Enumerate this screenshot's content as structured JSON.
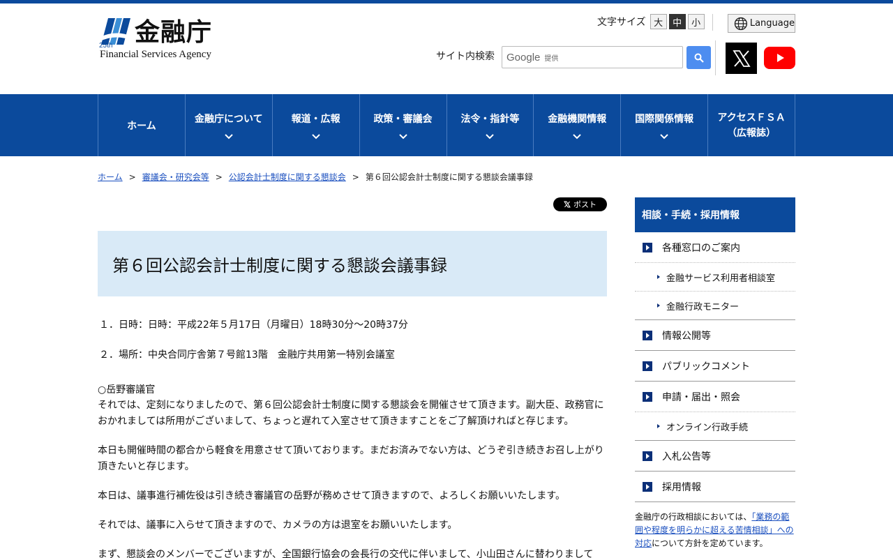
{
  "header": {
    "logo_text": "金融庁",
    "logo_en": "Financial Services Agency",
    "logo_badge": "25th",
    "font_size_label": "文字サイズ",
    "font_sizes": [
      "大",
      "中",
      "小"
    ],
    "font_size_active": "中",
    "language_label": "Language",
    "search_label": "サイト内検索",
    "search_google": "Google",
    "search_provided": "提供"
  },
  "nav": {
    "items": [
      {
        "label": "ホーム",
        "has_menu": false
      },
      {
        "label": "金融庁について",
        "has_menu": true
      },
      {
        "label": "報道・広報",
        "has_menu": true
      },
      {
        "label": "政策・審議会",
        "has_menu": true
      },
      {
        "label": "法令・指針等",
        "has_menu": true
      },
      {
        "label": "金融機関情報",
        "has_menu": true
      },
      {
        "label": "国際関係情報",
        "has_menu": true
      },
      {
        "label_line1": "アクセスＦＳＡ",
        "label_line2": "（広報誌）",
        "has_menu": false
      }
    ]
  },
  "breadcrumb": {
    "items": [
      "ホーム",
      "審議会・研究会等",
      "公認会計士制度に関する懇談会"
    ],
    "current": "第６回公認会計士制度に関する懇談会議事録",
    "separator": ">"
  },
  "post_button": "ポスト",
  "page": {
    "title": "第６回公認会計士制度に関する懇談会議事録",
    "item1": "１．日時：日時：平成22年５月17日（月曜日）18時30分～20時37分",
    "item2": "２．場所：中央合同庁舎第７号館13階　金融庁共用第一特別会議室",
    "speaker": "○岳野審議官",
    "para1": "それでは、定刻になりましたので、第６回公認会計士制度に関する懇談会を開催させて頂きます。副大臣、政務官におかれましては所用がございまして、ちょっと遅れて入室させて頂きますことをご了解頂ければと存じます。",
    "para2": "本日も開催時間の都合から軽食を用意させて頂いております。まだお済みでない方は、どうぞ引き続きお召し上がり頂きたいと存じます。",
    "para3": "本日は、議事進行補佐役は引き続き審議官の岳野が務めさせて頂きますので、よろしくお願いいたします。",
    "para4": "それでは、議事に入らせて頂きますので、カメラの方は退室をお願いいたします。",
    "para5": "まず、懇談会のメンバーでございますが、全国銀行協会の会長行の交代に伴いまして、小山田さんに替わりまして"
  },
  "sidebar": {
    "heading": "相談・手続・採用情報",
    "item_madoguchi": "各種窓口のご案内",
    "sub_soudan": "金融サービス利用者相談室",
    "sub_monitor": "金融行政モニター",
    "item_joho": "情報公開等",
    "item_public": "パブリックコメント",
    "item_shinsei": "申請・届出・照会",
    "sub_online": "オンライン行政手続",
    "item_nyusatsu": "入札公告等",
    "item_saiyo": "採用情報",
    "note_before": "金融庁の行政相談においては、",
    "note_link": "「業務の範囲や程度を明らかに超える苦情相談」への対応",
    "note_after": "について方針を定めています。"
  },
  "colors": {
    "brand_blue": "#0b4a9c",
    "title_bg": "#d9eaf7",
    "link": "#1a4fbf"
  }
}
